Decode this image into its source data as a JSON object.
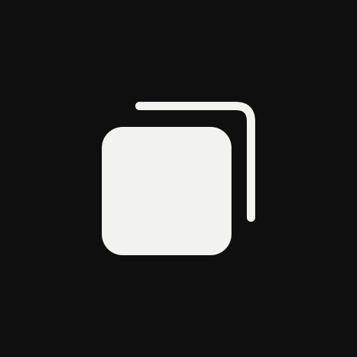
{
  "app_icon": {
    "icon_name": "copy-icon",
    "colors": {
      "background": "#0f0f0f",
      "foreground": "#f2f2ee"
    }
  }
}
